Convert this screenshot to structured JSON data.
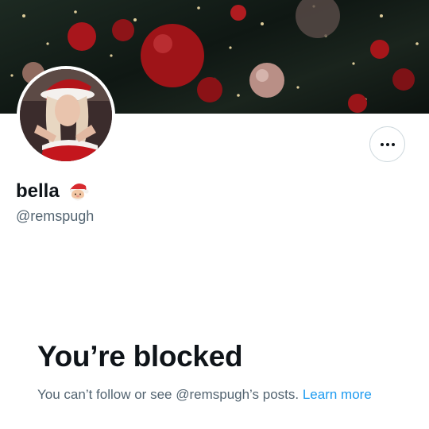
{
  "profile": {
    "display_name": "bella",
    "name_emoji": "santa-emoji",
    "handle": "@remspugh"
  },
  "more_button": {
    "icon": "more-horizontal-icon"
  },
  "blocked": {
    "title": "You’re blocked",
    "message": "You can’t follow or see @remspugh’s posts.",
    "link_label": "Learn more"
  },
  "colors": {
    "text_primary": "#0f1419",
    "text_secondary": "#536471",
    "link": "#1d9bf0",
    "border": "#cfd9de"
  }
}
